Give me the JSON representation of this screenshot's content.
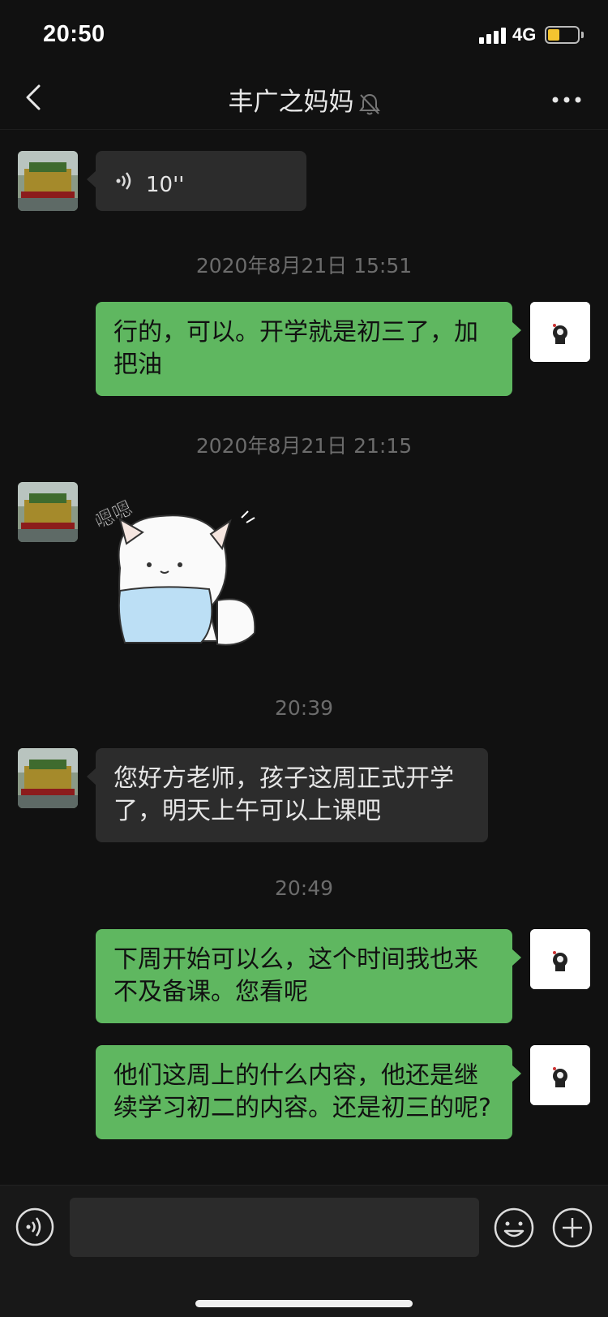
{
  "status_bar": {
    "time": "20:50",
    "network": "4G",
    "battery_level": 0.35
  },
  "nav": {
    "title": "丰广之妈妈",
    "back_icon": "chevron-left-icon",
    "mute_icon": "bell-muted-icon",
    "more_icon": "more-dots-icon"
  },
  "messages": [
    {
      "type": "voice",
      "side": "left",
      "duration": "10''"
    },
    {
      "type": "timestamp",
      "text": "2020年8月21日 15:51"
    },
    {
      "type": "text",
      "side": "right",
      "text": "行的，可以。开学就是初三了，加把油"
    },
    {
      "type": "timestamp",
      "text": "2020年8月21日 21:15"
    },
    {
      "type": "sticker",
      "side": "left",
      "text": "嗯嗯"
    },
    {
      "type": "timestamp",
      "text": "20:39"
    },
    {
      "type": "text",
      "side": "left",
      "text": "您好方老师，孩子这周正式开学了，明天上午可以上课吧"
    },
    {
      "type": "timestamp",
      "text": "20:49"
    },
    {
      "type": "text",
      "side": "right",
      "text": "下周开始可以么，这个时间我也来不及备课。您看呢"
    },
    {
      "type": "text",
      "side": "right",
      "text": "他们这周上的什么内容，他还是继续学习初二的内容。还是初三的呢?"
    }
  ],
  "input": {
    "value": ""
  },
  "colors": {
    "background": "#111111",
    "bubble_out": "#5fb760",
    "bubble_in": "#2c2c2c"
  }
}
